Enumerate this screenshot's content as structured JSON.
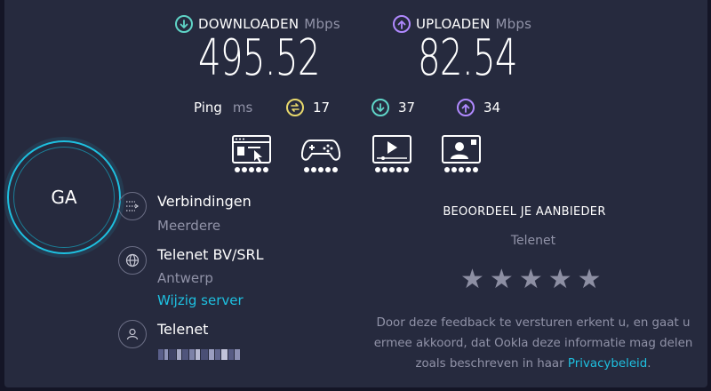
{
  "download": {
    "label": "DOWNLOADEN",
    "unit": "Mbps",
    "value": "495.52",
    "icon": "download-arrow-icon",
    "color": "#5fd4c7"
  },
  "upload": {
    "label": "UPLOADEN",
    "unit": "Mbps",
    "value": "82.54",
    "icon": "upload-arrow-icon",
    "color": "#b089ff"
  },
  "ping": {
    "label": "Ping",
    "unit": "ms",
    "idle": {
      "value": "17",
      "icon": "ping-idle-icon",
      "color": "#e8d86c"
    },
    "download": {
      "value": "37",
      "icon": "ping-download-icon",
      "color": "#5fd4c7"
    },
    "upload": {
      "value": "34",
      "icon": "ping-upload-icon",
      "color": "#b089ff"
    }
  },
  "usage_icons": [
    {
      "name": "browsing-icon",
      "dots": 5
    },
    {
      "name": "gaming-icon",
      "dots": 5
    },
    {
      "name": "video-streaming-icon",
      "dots": 5
    },
    {
      "name": "video-chat-icon",
      "dots": 5
    }
  ],
  "go_button": {
    "label": "GA",
    "accent": "#1ec0e0"
  },
  "connections": {
    "title": "Verbindingen",
    "value": "Meerdere",
    "icon": "connections-icon"
  },
  "server": {
    "title": "Telenet BV/SRL",
    "location": "Antwerp",
    "change_link": "Wijzig server",
    "icon": "globe-icon"
  },
  "provider": {
    "title": "Telenet",
    "icon": "user-icon"
  },
  "rating": {
    "title": "BEOORDEEL JE AANBIEDER",
    "provider": "Telenet",
    "stars": 5,
    "disclaimer_1": "Door deze feedback te versturen erkent u, en gaat u",
    "disclaimer_2": "ermee akkoord, dat Ookla deze informatie mag delen",
    "disclaimer_3": "zoals beschreven in haar",
    "privacy_link": "Privacybeleid",
    "period": "."
  }
}
